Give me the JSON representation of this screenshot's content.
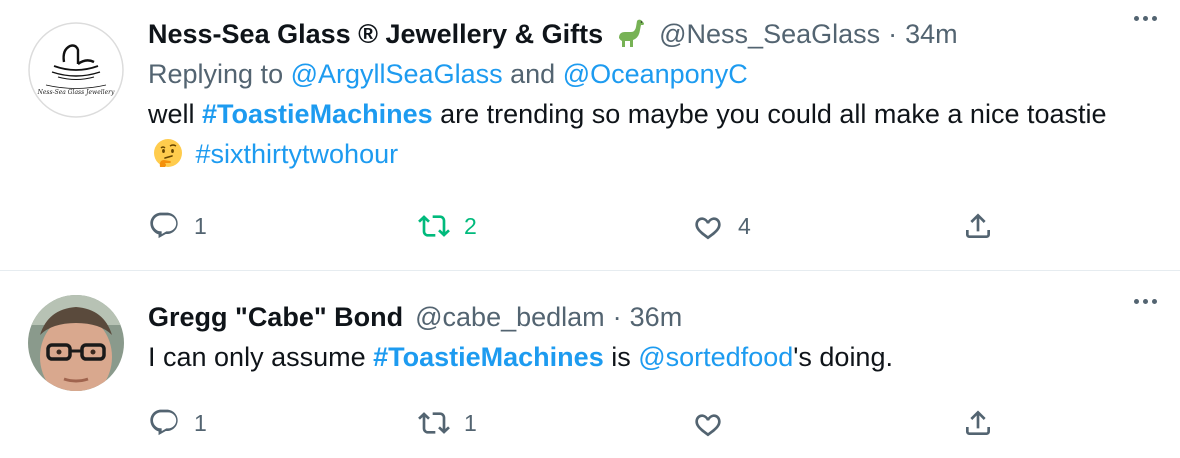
{
  "tweets": [
    {
      "display_name": "Ness-Sea Glass ® Jewellery & Gifts",
      "name_emoji": "sauropod-emoji",
      "handle": "@Ness_SeaGlass",
      "separator": "·",
      "time": "34m",
      "avatar": {
        "icon": "ness-sea-glass-logo",
        "caption": "Ness-Sea Glass Jewellery"
      },
      "reply_prefix": "Replying to",
      "reply_to_1": "@ArgyllSeaGlass",
      "reply_and": "and",
      "reply_to_2": "@OceanponyC",
      "text_pre": "well",
      "hashtag_1": "#ToastieMachines",
      "text_mid": "are trending so maybe you could all make a nice toastie",
      "text_emoji": "thinking-face-emoji",
      "hashtag_2": "#sixthirtytwohour",
      "replies": "1",
      "retweets": "2",
      "likes": "4",
      "retweeted": true
    },
    {
      "display_name": "Gregg \"Cabe\" Bond",
      "handle": "@cabe_bedlam",
      "separator": "·",
      "time": "36m",
      "avatar": {
        "icon": "user-photo-avatar"
      },
      "text_pre": "I can only assume",
      "hashtag_1": "#ToastieMachines",
      "text_mid": "is",
      "mention": "@sortedfood",
      "text_post": "'s doing.",
      "replies": "1",
      "retweets": "1",
      "likes": ""
    }
  ],
  "colors": {
    "link": "#1d9bf0",
    "secondary_text": "#536471",
    "retweet_active": "#00ba7c",
    "divider": "#e6ecf0"
  }
}
